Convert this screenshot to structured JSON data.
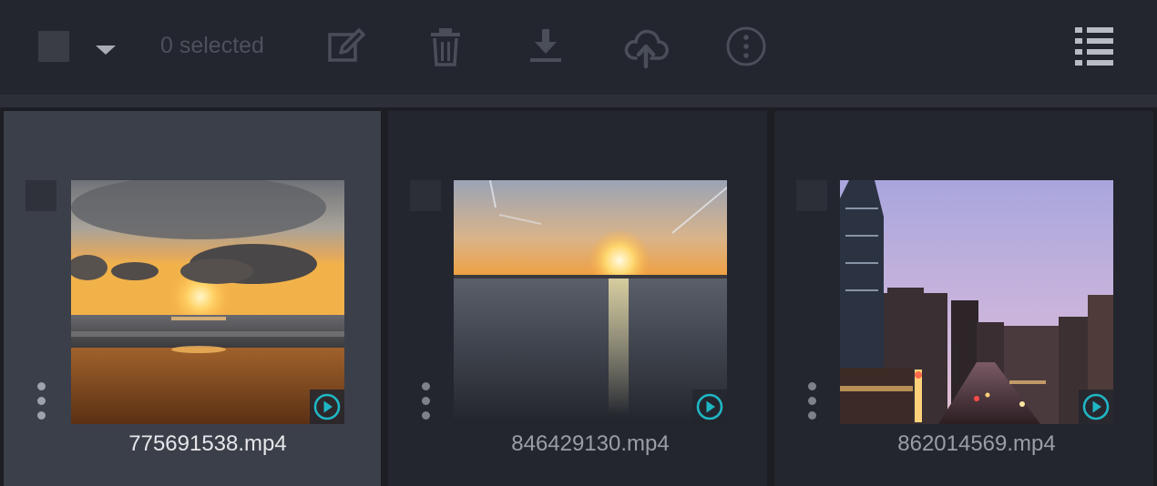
{
  "toolbar": {
    "selected_label": "0 selected",
    "icons": [
      "checkbox-icon",
      "caret-down-icon",
      "edit-icon",
      "trash-icon",
      "download-icon",
      "cloud-upload-icon",
      "more-icon",
      "list-view-icon"
    ]
  },
  "files": [
    {
      "name": "775691538.mp4",
      "selected": true,
      "thumbnail": "beach-sunset",
      "type_icon": "play-icon"
    },
    {
      "name": "846429130.mp4",
      "selected": false,
      "thumbnail": "ocean-sunset",
      "type_icon": "play-icon"
    },
    {
      "name": "862014569.mp4",
      "selected": false,
      "thumbnail": "city-dusk",
      "type_icon": "play-icon"
    }
  ],
  "colors": {
    "background": "#1c1e24",
    "toolbar": "#23262e",
    "card": "#23262e",
    "card_selected": "#3b3f49",
    "accent": "#1fb6c4",
    "muted_text": "#4d515b"
  }
}
